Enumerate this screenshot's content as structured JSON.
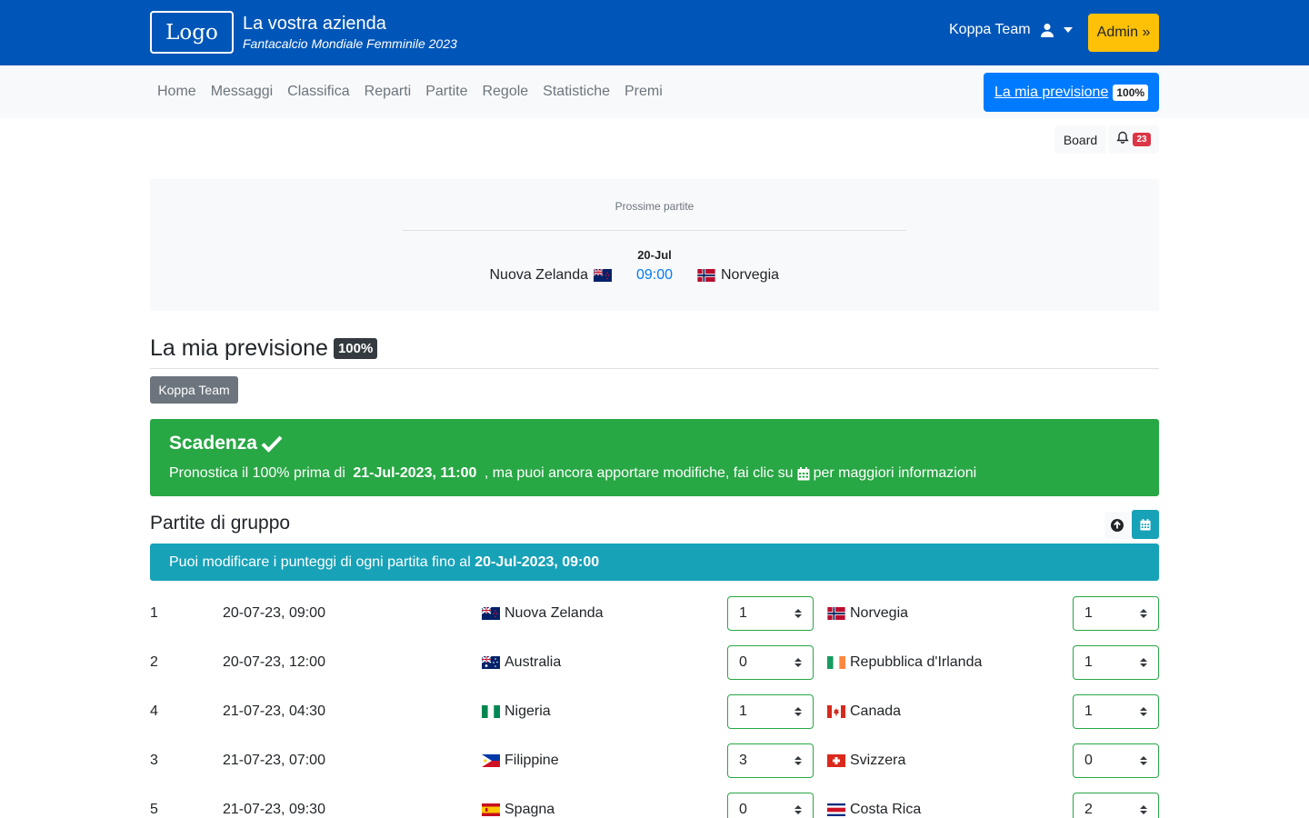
{
  "header": {
    "logo": "Logo",
    "title": "La vostra azienda",
    "subtitle": "Fantacalcio Mondiale Femminile 2023",
    "user": "Koppa Team",
    "admin": "Admin »"
  },
  "nav": {
    "items": [
      "Home",
      "Messaggi",
      "Classifica",
      "Reparti",
      "Partite",
      "Regole",
      "Statistiche",
      "Premi"
    ],
    "prediction_label": "La mia previsione",
    "prediction_pct": "100%"
  },
  "toolbar": {
    "board": "Board",
    "notifications": "23"
  },
  "upcoming": {
    "heading": "Prossime partite",
    "date": "20-Jul",
    "home": "Nuova Zelanda",
    "time": "09:00",
    "away": "Norvegia"
  },
  "section": {
    "title": "La mia previsione",
    "pct": "100%",
    "team": "Koppa Team"
  },
  "deadline": {
    "title": "Scadenza",
    "msg_prefix": "Pronostica il 100% prima di ",
    "msg_date": "21-Jul-2023, 11:00",
    "msg_mid": " , ma puoi ancora apportare modifiche, fai clic su",
    "msg_suffix": "per maggiori informazioni"
  },
  "group": {
    "title": "Partite di gruppo",
    "info_prefix": "Puoi modificare i punteggi di ogni partita fino al ",
    "info_date": "20-Jul-2023, 09:00"
  },
  "matches": [
    {
      "num": "1",
      "dt": "20-07-23, 09:00",
      "home": "Nuova Zelanda",
      "hs": "1",
      "away": "Norvegia",
      "as": "1"
    },
    {
      "num": "2",
      "dt": "20-07-23, 12:00",
      "home": "Australia",
      "hs": "0",
      "away": "Repubblica d'Irlanda",
      "as": "1"
    },
    {
      "num": "4",
      "dt": "21-07-23, 04:30",
      "home": "Nigeria",
      "hs": "1",
      "away": "Canada",
      "as": "1"
    },
    {
      "num": "3",
      "dt": "21-07-23, 07:00",
      "home": "Filippine",
      "hs": "3",
      "away": "Svizzera",
      "as": "0"
    },
    {
      "num": "5",
      "dt": "21-07-23, 09:30",
      "home": "Spagna",
      "hs": "0",
      "away": "Costa Rica",
      "as": "2"
    }
  ]
}
